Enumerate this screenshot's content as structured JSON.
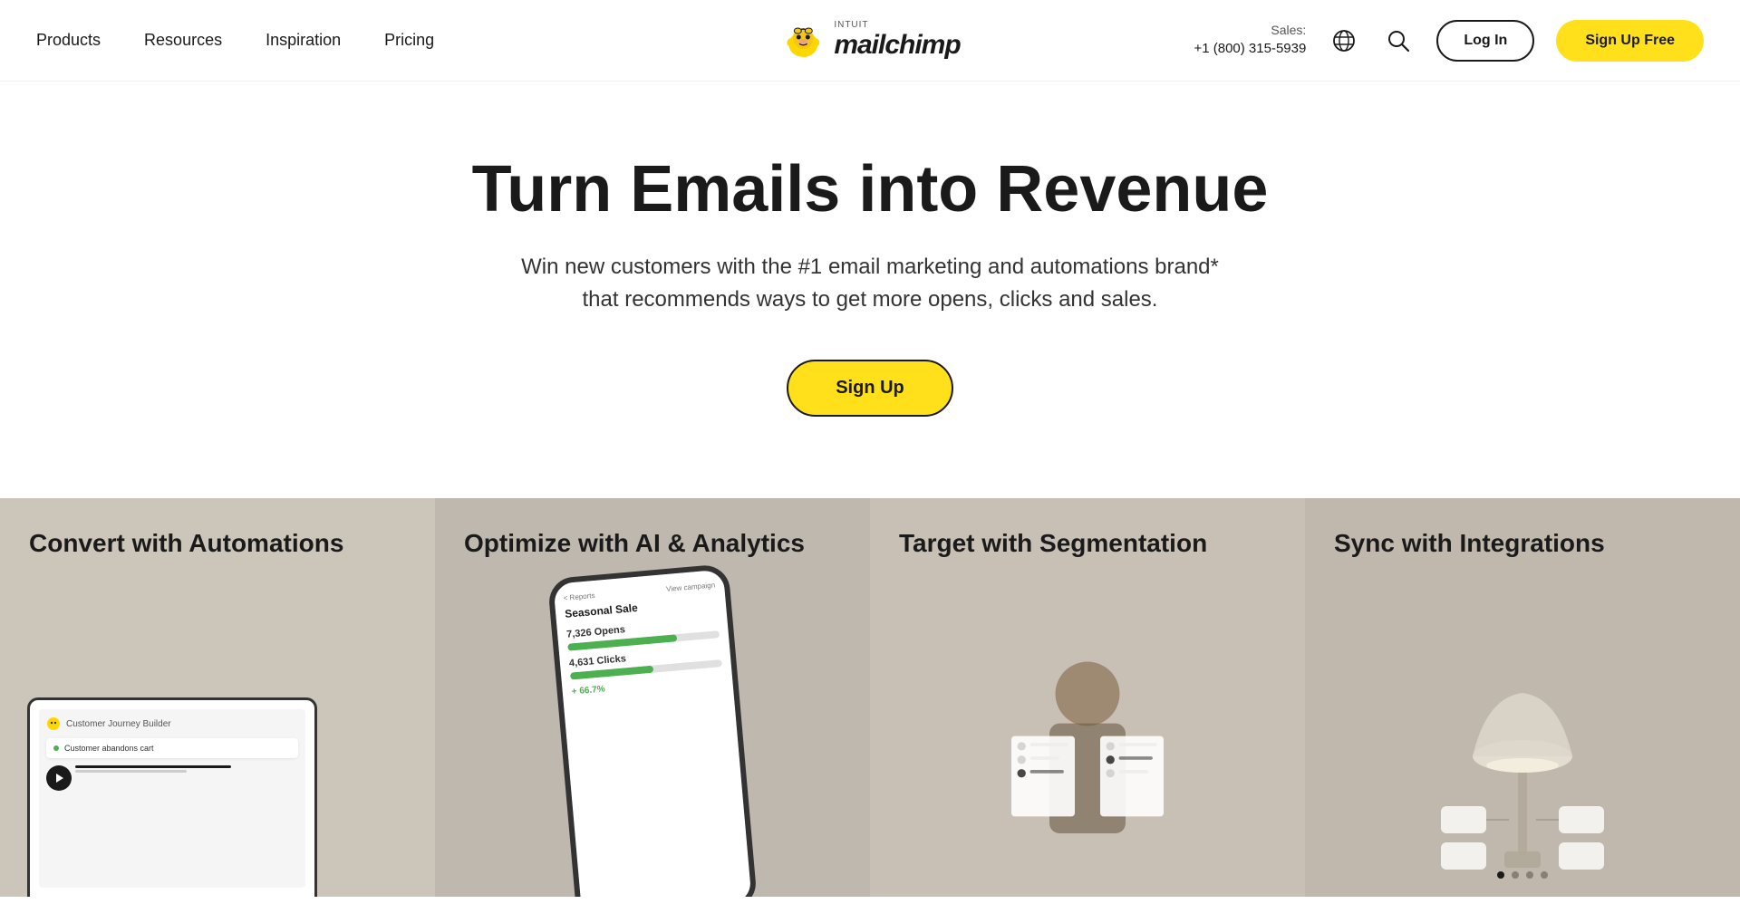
{
  "nav": {
    "items": [
      {
        "label": "Products",
        "id": "products"
      },
      {
        "label": "Resources",
        "id": "resources"
      },
      {
        "label": "Inspiration",
        "id": "inspiration"
      },
      {
        "label": "Pricing",
        "id": "pricing"
      }
    ],
    "logo": {
      "intuit": "INTUIT",
      "brand": "mailchimp"
    },
    "sales": {
      "label": "Sales:",
      "phone": "+1 (800) 315-5939"
    },
    "login_label": "Log In",
    "signup_label": "Sign Up Free"
  },
  "hero": {
    "title": "Turn Emails into Revenue",
    "subtitle": "Win new customers with the #1 email marketing and automations brand* that recommends ways to get more opens, clicks and sales.",
    "cta_label": "Sign Up"
  },
  "features": [
    {
      "id": "automations",
      "title": "Convert with Automations",
      "screen_title": "Customer Journey Builder",
      "screen_row": "Customer abandons cart"
    },
    {
      "id": "ai-analytics",
      "title": "Optimize with AI & Analytics",
      "phone_header": "< Reports",
      "phone_campaign": "View campaign",
      "phone_title": "Seasonal Sale",
      "phone_opens_label": "Opens",
      "phone_opens_value": "7,326",
      "phone_clicks_label": "Clicks",
      "phone_clicks_value": "4,631",
      "phone_percent": "+ 66.7%"
    },
    {
      "id": "segmentation",
      "title": "Target with Segmentation"
    },
    {
      "id": "integrations",
      "title": "Sync with Integrations"
    }
  ],
  "colors": {
    "yellow": "#ffe01b",
    "dark": "#1a1a1a",
    "feature_bg1": "#ccc5ba",
    "feature_bg2": "#bfb8ae",
    "feature_bg3": "#c8c0b4",
    "feature_bg4": "#c0b8ac"
  }
}
